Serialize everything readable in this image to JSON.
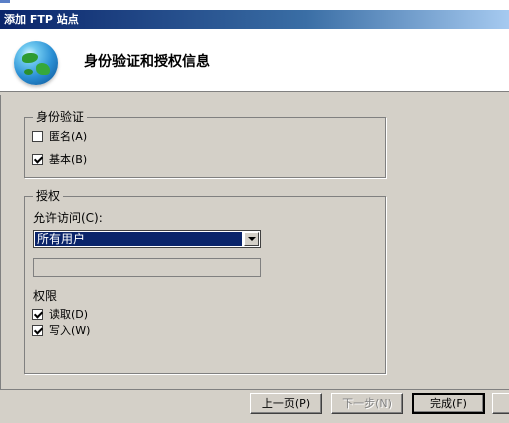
{
  "window": {
    "title": "添加 FTP 站点"
  },
  "header": {
    "title": "身份验证和授权信息",
    "icon": "globe-icon"
  },
  "auth": {
    "legend": "身份验证",
    "anonymous": {
      "label": "匿名(A)",
      "checked": false
    },
    "basic": {
      "label": "基本(B)",
      "checked": true
    }
  },
  "authz": {
    "legend": "授权",
    "allow_label": "允许访问(C):",
    "allow_selected": "所有用户",
    "permissions_label": "权限",
    "read": {
      "label": "读取(D)",
      "checked": true
    },
    "write": {
      "label": "写入(W)",
      "checked": true
    }
  },
  "buttons": {
    "prev": "上一页(P)",
    "next": "下一步(N)",
    "finish": "完成(F)"
  }
}
